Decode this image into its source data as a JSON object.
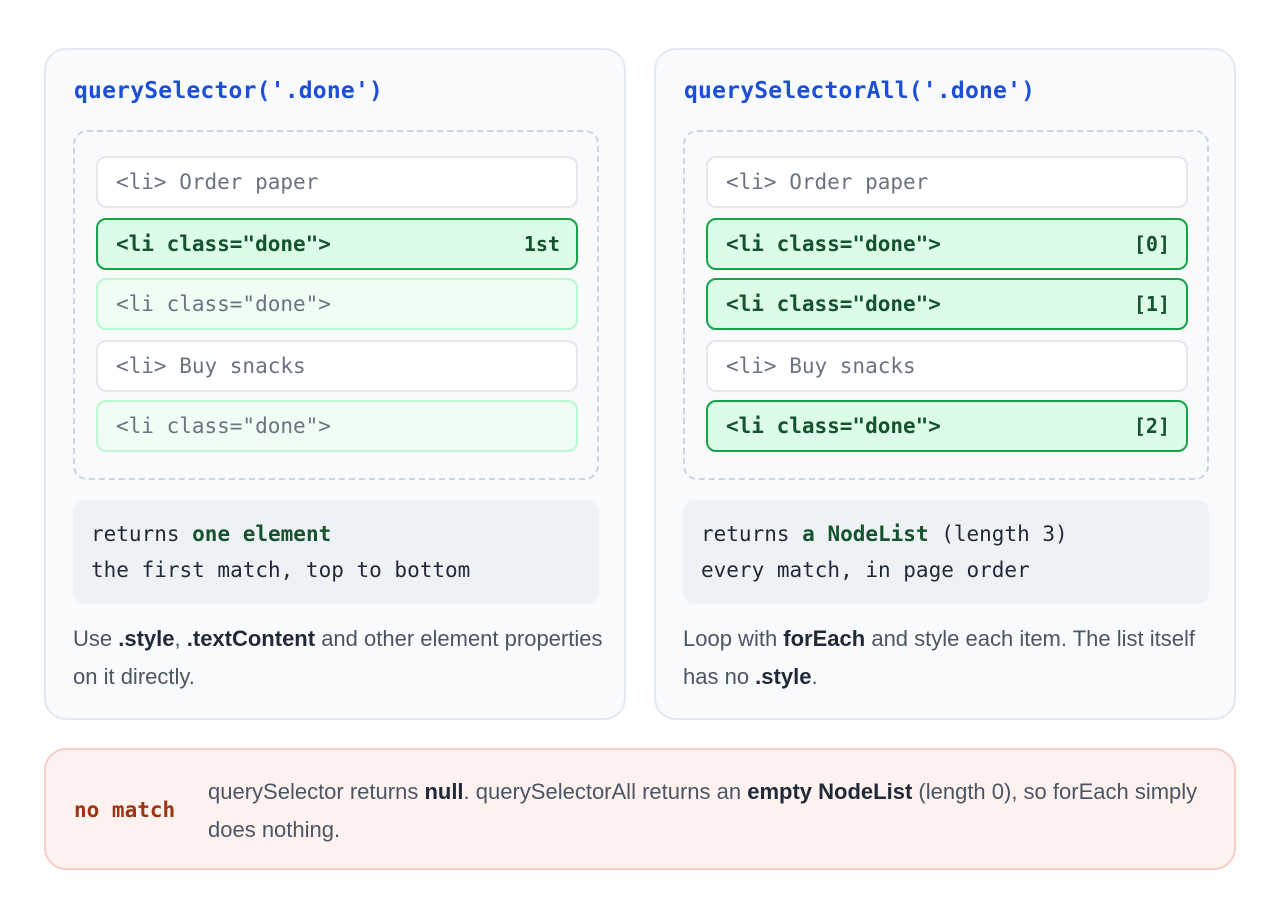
{
  "left": {
    "title": "querySelector('.done')",
    "items": [
      {
        "text": "<li> Order paper",
        "state": "plain",
        "tag": ""
      },
      {
        "text": "<li class=\"done\">",
        "state": "match",
        "tag": "1st"
      },
      {
        "text": "<li class=\"done\">",
        "state": "faded",
        "tag": ""
      },
      {
        "text": "<li> Buy snacks",
        "state": "plain",
        "tag": ""
      },
      {
        "text": "<li class=\"done\">",
        "state": "faded",
        "tag": ""
      }
    ],
    "result": {
      "line1_pre": "returns ",
      "line1_bold": "one element",
      "line1_post": "",
      "line2": "the first match, top to bottom"
    },
    "note": {
      "p1": "Use ",
      "b1": ".style",
      "p2": ", ",
      "b2": ".textContent",
      "p3": " and other element properties on it directly."
    }
  },
  "right": {
    "title": "querySelectorAll('.done')",
    "items": [
      {
        "text": "<li> Order paper",
        "state": "plain",
        "tag": ""
      },
      {
        "text": "<li class=\"done\">",
        "state": "match",
        "tag": "[0]"
      },
      {
        "text": "<li class=\"done\">",
        "state": "match",
        "tag": "[1]"
      },
      {
        "text": "<li> Buy snacks",
        "state": "plain",
        "tag": ""
      },
      {
        "text": "<li class=\"done\">",
        "state": "match",
        "tag": "[2]"
      }
    ],
    "result": {
      "line1_pre": "returns ",
      "line1_bold": "a NodeList",
      "line1_post": " (length 3)",
      "line2": "every match, in page order"
    },
    "note": {
      "p1": "Loop with ",
      "b1": "forEach",
      "p2": " and style each item. The list itself has no ",
      "b2": ".style",
      "p3": "."
    }
  },
  "callout": {
    "tag": "no match",
    "p1": "querySelector returns ",
    "b1": "null",
    "p2": ". querySelectorAll returns an ",
    "b2": "empty NodeList",
    "p3": " (length 0), so forEach simply does nothing."
  },
  "colors": {
    "title_blue": "#1d4ed8",
    "match_green": "#16a34a",
    "match_fill": "#dcfce7",
    "warn_text": "#9a3412",
    "warn_fill": "#fef2f0"
  }
}
